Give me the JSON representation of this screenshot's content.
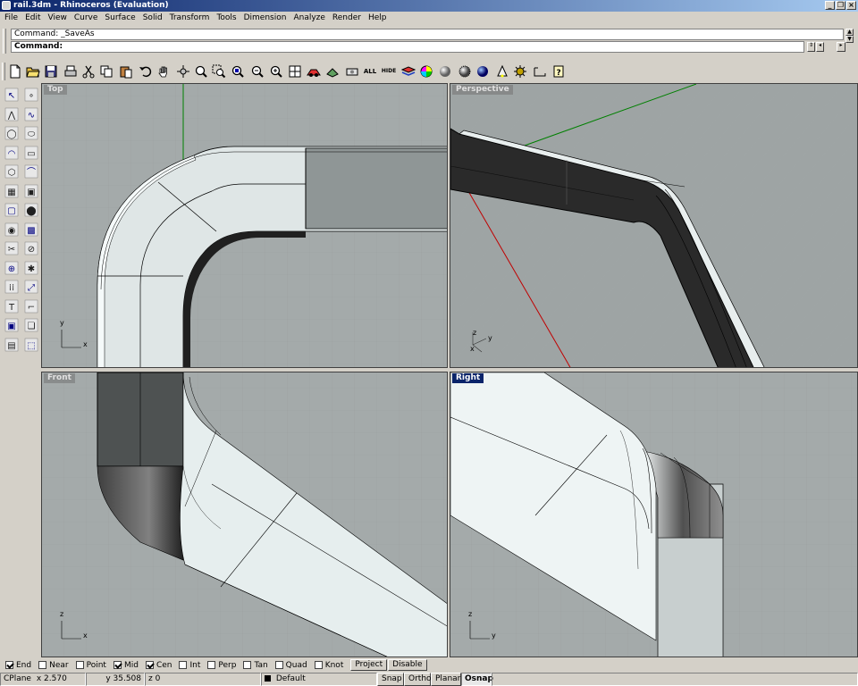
{
  "window": {
    "title": "rail.3dm - Rhinoceros (Evaluation)"
  },
  "menu": [
    "File",
    "Edit",
    "View",
    "Curve",
    "Surface",
    "Solid",
    "Transform",
    "Tools",
    "Dimension",
    "Analyze",
    "Render",
    "Help"
  ],
  "command": {
    "history": "Command: _SaveAs",
    "prompt_label": "Command:",
    "input_value": ""
  },
  "toolbar": {
    "icons": [
      "new-icon",
      "open-icon",
      "save-icon",
      "print-icon",
      "cut-icon",
      "copy-icon",
      "paste-icon",
      "undo-icon",
      "pan-icon",
      "rotate-view-icon",
      "zoom-dynamic-icon",
      "zoom-window-icon",
      "zoom-extents-icon",
      "zoom-selected-icon",
      "zoom-extents-all-icon",
      "four-viewports-icon",
      "select-all-icon",
      "show-icon",
      "hide-icon",
      "layer-icon",
      "color-icon",
      "shade-icon",
      "render-icon",
      "render-preview-icon",
      "light-icon",
      "materials-icon",
      "dimension-icon",
      "help-icon"
    ],
    "all_label": "ALL",
    "hide_label": "HIDE"
  },
  "left_toolbar": {
    "icons": [
      "select-arrow-icon",
      "point-icon",
      "polyline-icon",
      "curve-icon",
      "circle-icon",
      "ellipse-icon",
      "arc-icon",
      "rectangle-icon",
      "polygon-icon",
      "fillet-icon",
      "surface-icon",
      "extrude-icon",
      "box-icon",
      "boolean-icon",
      "cylinder-icon",
      "mesh-icon",
      "trim-icon",
      "split-icon",
      "join-icon",
      "explode-icon",
      "array-icon",
      "transform-icon",
      "text-icon",
      "dimension-icon",
      "group-icon",
      "block-icon",
      "render-icon",
      "analyze-icon"
    ]
  },
  "viewports": {
    "top": {
      "label": "Top",
      "axis_x": "x",
      "axis_y": "y"
    },
    "perspective": {
      "label": "Perspective",
      "axis_x": "x",
      "axis_y": "y",
      "axis_z": "z"
    },
    "front": {
      "label": "Front",
      "axis_x": "x",
      "axis_z": "z"
    },
    "right": {
      "label": "Right",
      "axis_y": "y",
      "axis_z": "z",
      "active": true
    }
  },
  "osnap": {
    "items": [
      {
        "label": "End",
        "checked": true
      },
      {
        "label": "Near",
        "checked": false
      },
      {
        "label": "Point",
        "checked": false
      },
      {
        "label": "Mid",
        "checked": true
      },
      {
        "label": "Cen",
        "checked": true
      },
      {
        "label": "Int",
        "checked": false
      },
      {
        "label": "Perp",
        "checked": false
      },
      {
        "label": "Tan",
        "checked": false
      },
      {
        "label": "Quad",
        "checked": false
      },
      {
        "label": "Knot",
        "checked": false
      }
    ],
    "project_label": "Project",
    "disable_label": "Disable"
  },
  "status": {
    "cplane": "CPlane",
    "x": "x 2.570",
    "y": "y 35.508",
    "z": "z 0",
    "layer": "Default",
    "snap": "Snap",
    "ortho": "Ortho",
    "planar": "Planar",
    "osnap": "Osnap"
  }
}
